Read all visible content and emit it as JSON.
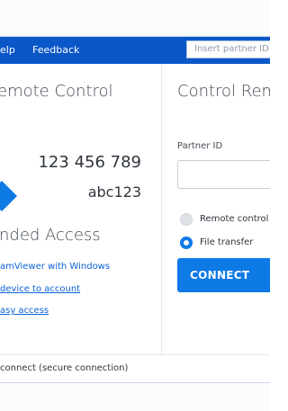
{
  "menu": {
    "help_label": "elp",
    "feedback_label": "Feedback",
    "partner_search_placeholder": "Insert partner ID"
  },
  "left": {
    "remote_control_title": "emote Control",
    "your_id": "123 456 789",
    "password": "abc123",
    "unattended_title": "nded Access",
    "links": [
      "amViewer with Windows",
      "device to account",
      "asy access"
    ]
  },
  "right": {
    "title": "Control Rem",
    "partner_id_label": "Partner ID",
    "radio_remote_control": "Remote control",
    "radio_file_transfer": "File transfer",
    "connect_label": "CONNECT"
  },
  "status": {
    "text": "connect (secure connection)"
  },
  "colors": {
    "brand_blue": "#0a57c8",
    "accent_blue": "#0e7ae6",
    "link_blue": "#0a63d6"
  }
}
